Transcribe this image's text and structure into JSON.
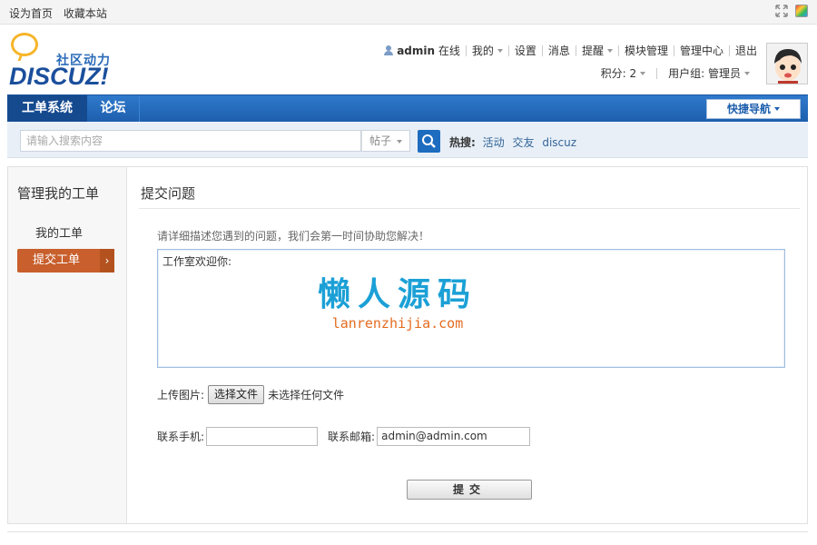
{
  "topbar": {
    "set_homepage": "设为首页",
    "bookmark": "收藏本站"
  },
  "logo": {
    "slogan": "社区动力",
    "brand": "DISCUZ!"
  },
  "usernav": {
    "username": "admin",
    "online": "在线",
    "mine": "我的",
    "settings": "设置",
    "messages": "消息",
    "reminders": "提醒",
    "module_manage": "模块管理",
    "admin_center": "管理中心",
    "logout": "退出"
  },
  "userinfo": {
    "points": "积分: 2",
    "group": "用户组: 管理员"
  },
  "navbar": {
    "tab_ticket": "工单系统",
    "tab_forum": "论坛",
    "quicknav": "快捷导航"
  },
  "search": {
    "placeholder": "请输入搜索内容",
    "type": "帖子",
    "hot_label": "热搜:",
    "hot_words": [
      "活动",
      "交友",
      "discuz"
    ]
  },
  "sidebar": {
    "title": "管理我的工单",
    "my_tickets": "我的工单",
    "submit_ticket": "提交工单",
    "arrow": "›"
  },
  "content": {
    "title": "提交问题",
    "hint": "请详细描述您遇到的问题，我们会第一时间协助您解决！",
    "editor_text": "工作室欢迎你:",
    "watermark_cn": "懒人源码",
    "watermark_en": "lanrenzhijia.com",
    "upload_label": "上传图片:",
    "file_button": "选择文件",
    "file_status": "未选择任何文件",
    "phone_label": "联系手机:",
    "phone_value": "",
    "email_label": "联系邮箱:",
    "email_value": "admin@admin.com",
    "submit": "提交"
  },
  "colors": {
    "nav_blue": "#1e5fae",
    "active_orange": "#c85f2c",
    "watermark_blue": "#1ba0d6",
    "watermark_orange": "#e46b1f"
  }
}
